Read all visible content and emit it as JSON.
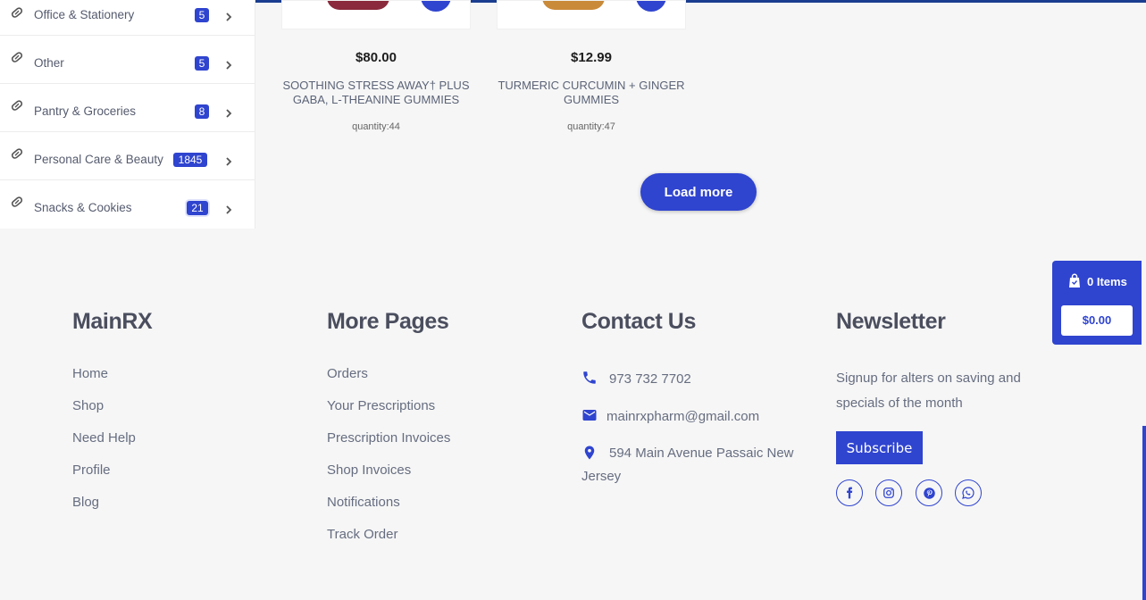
{
  "sidebar": {
    "categories": [
      {
        "label": "Office & Stationery",
        "count": "5"
      },
      {
        "label": "Other",
        "count": "5"
      },
      {
        "label": "Pantry & Groceries",
        "count": "8"
      },
      {
        "label": "Personal Care & Beauty",
        "count": "1845"
      },
      {
        "label": "Snacks & Cookies",
        "count": "21"
      }
    ]
  },
  "products": [
    {
      "price": "$80.00",
      "name": "SOOTHING STRESS AWAY† PLUS GABA, L-THEANINE GUMMIES",
      "quantity": "quantity:44"
    },
    {
      "price": "$12.99",
      "name": "TURMERIC CURCUMIN + GINGER GUMMIES",
      "quantity": "quantity:47"
    }
  ],
  "load_more_label": "Load more",
  "footer": {
    "brand": {
      "title": "MainRX",
      "links": [
        "Home",
        "Shop",
        "Need Help",
        "Profile",
        "Blog"
      ]
    },
    "more_pages": {
      "title": "More Pages",
      "links": [
        "Orders",
        "Your Prescriptions",
        "Prescription Invoices",
        "Shop Invoices",
        "Notifications",
        "Track Order"
      ]
    },
    "contact": {
      "title": "Contact Us",
      "phone": "973 732 7702",
      "email": "mainrxpharm@gmail.com",
      "address": "594 Main Avenue Passaic New Jersey"
    },
    "newsletter": {
      "title": "Newsletter",
      "text": "Signup for alters on saving and specials of the month",
      "subscribe_label": "Subscribe",
      "social_icons": [
        "facebook-icon",
        "instagram-icon",
        "pinterest-icon",
        "whatsapp-icon"
      ]
    }
  },
  "floating_cart": {
    "items_label": "0 Items",
    "total": "$0.00"
  },
  "colors": {
    "accent": "#2f44cf",
    "background": "#f6f6f6",
    "top_border": "#1a3d8f"
  }
}
